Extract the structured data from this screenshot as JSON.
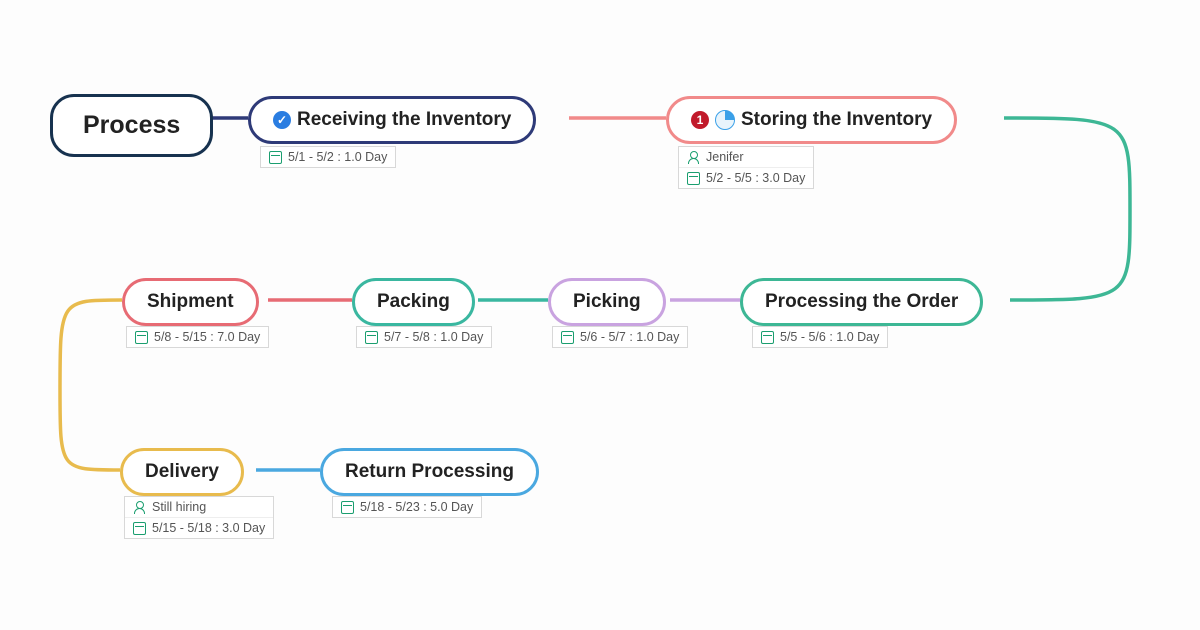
{
  "nodes": {
    "process": {
      "label": "Process"
    },
    "receiving": {
      "label": "Receiving the Inventory",
      "date": "5/1 - 5/2 : 1.0 Day"
    },
    "storing": {
      "label": "Storing the Inventory",
      "priority": "1",
      "assignee": "Jenifer",
      "date": "5/2 - 5/5 : 3.0 Day"
    },
    "processing": {
      "label": "Processing the Order",
      "date": "5/5 - 5/6 : 1.0 Day"
    },
    "picking": {
      "label": "Picking",
      "date": "5/6 - 5/7 : 1.0 Day"
    },
    "packing": {
      "label": "Packing",
      "date": "5/7 - 5/8 : 1.0 Day"
    },
    "shipment": {
      "label": "Shipment",
      "date": "5/8 - 5/15 : 7.0 Day"
    },
    "delivery": {
      "label": "Delivery",
      "assignee": "Still hiring",
      "date": "5/15 - 5/18 : 3.0 Day"
    },
    "return": {
      "label": "Return Processing",
      "date": "5/18 - 5/23 : 5.0 Day"
    }
  },
  "colors": {
    "process": "#17324f",
    "receiving": "#2e3a78",
    "storing": "#f18a8a",
    "processing": "#3db795",
    "picking": "#c9a3e0",
    "packing": "#3ab7a0",
    "shipment": "#e76b74",
    "delivery": "#e8bb4d",
    "return": "#4aa8e0"
  },
  "chart_data": {
    "type": "flow",
    "title": "Process",
    "nodes": [
      {
        "id": "process",
        "label": "Process"
      },
      {
        "id": "receiving",
        "label": "Receiving the Inventory",
        "start": "5/1",
        "end": "5/2",
        "duration_days": 1.0,
        "status": "done"
      },
      {
        "id": "storing",
        "label": "Storing the Inventory",
        "start": "5/2",
        "end": "5/5",
        "duration_days": 3.0,
        "assignee": "Jenifer",
        "priority": 1,
        "progress": 0.25
      },
      {
        "id": "processing",
        "label": "Processing the Order",
        "start": "5/5",
        "end": "5/6",
        "duration_days": 1.0
      },
      {
        "id": "picking",
        "label": "Picking",
        "start": "5/6",
        "end": "5/7",
        "duration_days": 1.0
      },
      {
        "id": "packing",
        "label": "Packing",
        "start": "5/7",
        "end": "5/8",
        "duration_days": 1.0
      },
      {
        "id": "shipment",
        "label": "Shipment",
        "start": "5/8",
        "end": "5/15",
        "duration_days": 7.0
      },
      {
        "id": "delivery",
        "label": "Delivery",
        "start": "5/15",
        "end": "5/18",
        "duration_days": 3.0,
        "assignee": "Still hiring"
      },
      {
        "id": "return",
        "label": "Return Processing",
        "start": "5/18",
        "end": "5/23",
        "duration_days": 5.0
      }
    ],
    "edges": [
      [
        "process",
        "receiving"
      ],
      [
        "receiving",
        "storing"
      ],
      [
        "storing",
        "processing"
      ],
      [
        "processing",
        "picking"
      ],
      [
        "picking",
        "packing"
      ],
      [
        "packing",
        "shipment"
      ],
      [
        "shipment",
        "delivery"
      ],
      [
        "delivery",
        "return"
      ]
    ]
  }
}
